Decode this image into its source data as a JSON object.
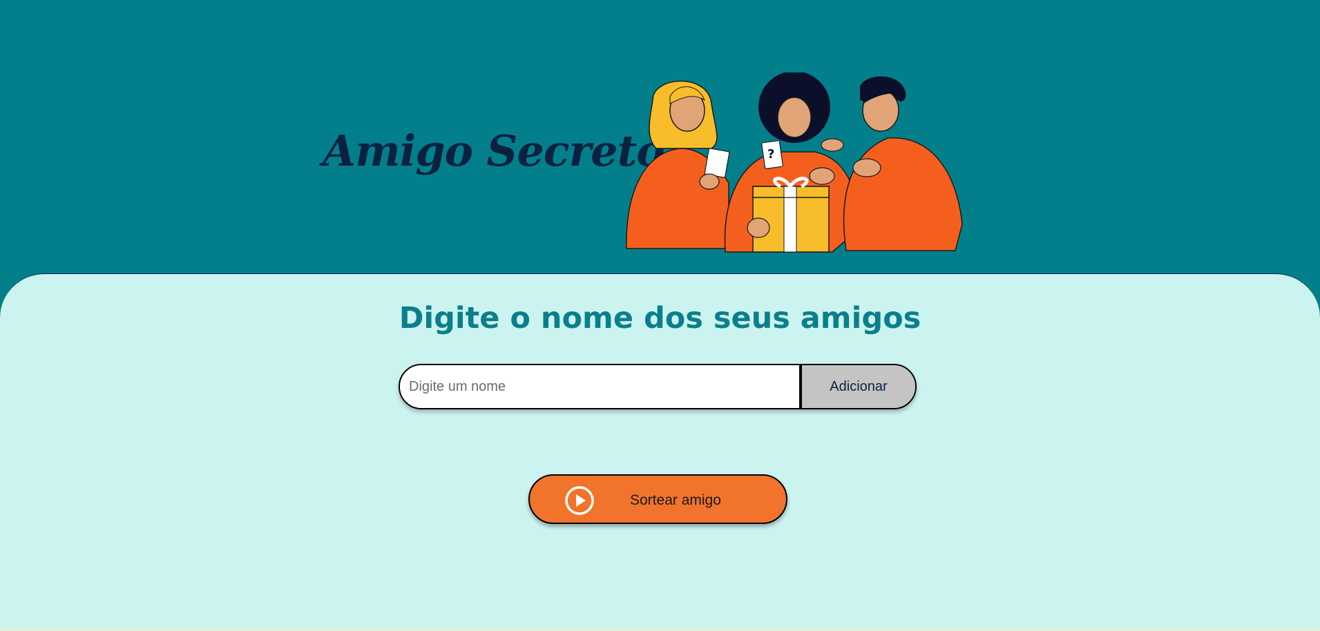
{
  "header": {
    "title": "Amigo Secreto",
    "illustration": "three-friends-gift-illustration"
  },
  "main": {
    "section_title": "Digite o nome dos seus amigos",
    "name_input": {
      "placeholder": "Digite um nome",
      "value": ""
    },
    "add_button_label": "Adicionar",
    "draw_button_label": "Sortear amigo",
    "draw_button_icon": "play-circle-icon"
  },
  "colors": {
    "header_bg": "#037f8c",
    "main_bg": "#cbf3ef",
    "title_color": "#0a2240",
    "section_title_color": "#0a7f8b",
    "add_button_bg": "#c4c4c4",
    "draw_button_bg": "#f2732c"
  }
}
